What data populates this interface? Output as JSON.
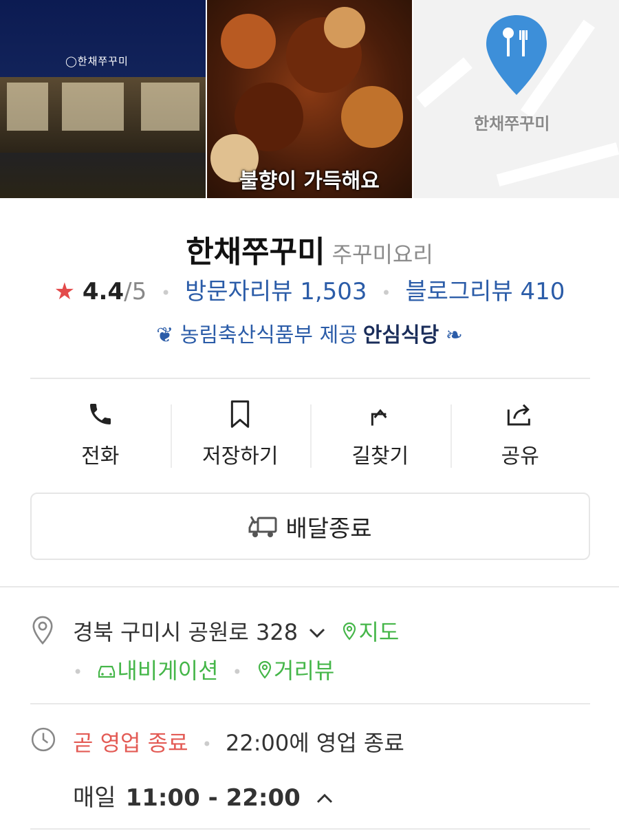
{
  "photos": {
    "night_sign": "◯한채쭈꾸미",
    "food_caption": "불향이 가득해요",
    "map_label": "한채쭈꾸미"
  },
  "place": {
    "name": "한채쭈꾸미",
    "category": "주꾸미요리"
  },
  "rating": {
    "star": "★",
    "score": "4.4",
    "max": "/5",
    "visitor_reviews": "방문자리뷰 1,503",
    "blog_reviews": "블로그리뷰 410"
  },
  "badge": {
    "provider": "농림축산식품부 제공",
    "label": "안심식당"
  },
  "actions": [
    {
      "label": "전화",
      "icon": "phone-icon"
    },
    {
      "label": "저장하기",
      "icon": "bookmark-icon"
    },
    {
      "label": "길찾기",
      "icon": "directions-icon"
    },
    {
      "label": "공유",
      "icon": "share-icon"
    }
  ],
  "delivery": {
    "label": "배달종료",
    "icon": "delivery-truck-icon"
  },
  "address": {
    "text": "경북 구미시 공원로 328",
    "map_link": "지도",
    "navigation_link": "내비게이션",
    "streetview_link": "거리뷰"
  },
  "hours": {
    "status": "곧 영업 종료",
    "closing": "22:00에 영업 종료",
    "days": "매일",
    "range": "11:00 - 22:00"
  },
  "colors": {
    "accent_blue": "#2b5ca8",
    "green": "#45b649",
    "red": "#e35b55",
    "star": "#e34a4a"
  }
}
